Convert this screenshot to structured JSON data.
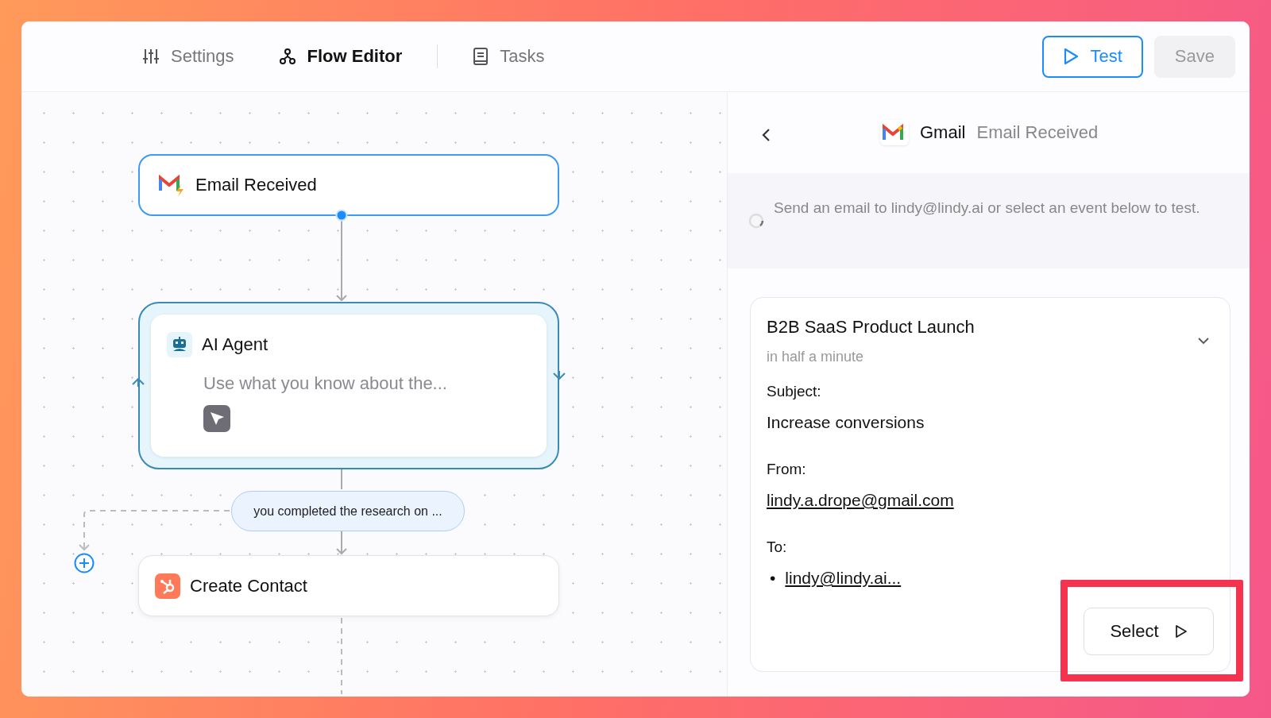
{
  "tabs": [
    {
      "label": "Settings",
      "selected": false
    },
    {
      "label": "Flow Editor",
      "selected": true
    },
    {
      "label": "Tasks",
      "selected": false
    }
  ],
  "actions": [
    {
      "label": "Test",
      "kind": "primary",
      "disabled": false
    },
    {
      "label": "Save",
      "kind": "plain",
      "disabled": true
    }
  ],
  "canvas": {
    "nodes": [
      {
        "kind": "trigger",
        "title": "Email Received",
        "selected": true
      },
      {
        "kind": "agent",
        "title": "AI Agent",
        "prompt": "Use what you know about the...",
        "selected": true
      },
      {
        "kind": "action",
        "title": "Create Contact",
        "selected": false
      }
    ],
    "condition": "you completed the research on ..."
  },
  "panel": {
    "app": "Gmail",
    "trigger": "Email Received",
    "status": "Send an email to lindy@lindy.ai or select an event below to test.",
    "event": {
      "title": "B2B SaaS Product Launch",
      "time": "in half a minute",
      "expanded": true,
      "fields": [
        {
          "label": "Subject:",
          "kind": "text",
          "values": [
            "Increase conversions"
          ]
        },
        {
          "label": "From:",
          "kind": "link",
          "values": [
            "lindy.a.drope@gmail.com"
          ]
        },
        {
          "label": "To:",
          "kind": "list",
          "bullet": "•",
          "values": [
            "lindy@lindy.ai..."
          ]
        }
      ],
      "button": "Select",
      "highlighted": true
    }
  }
}
